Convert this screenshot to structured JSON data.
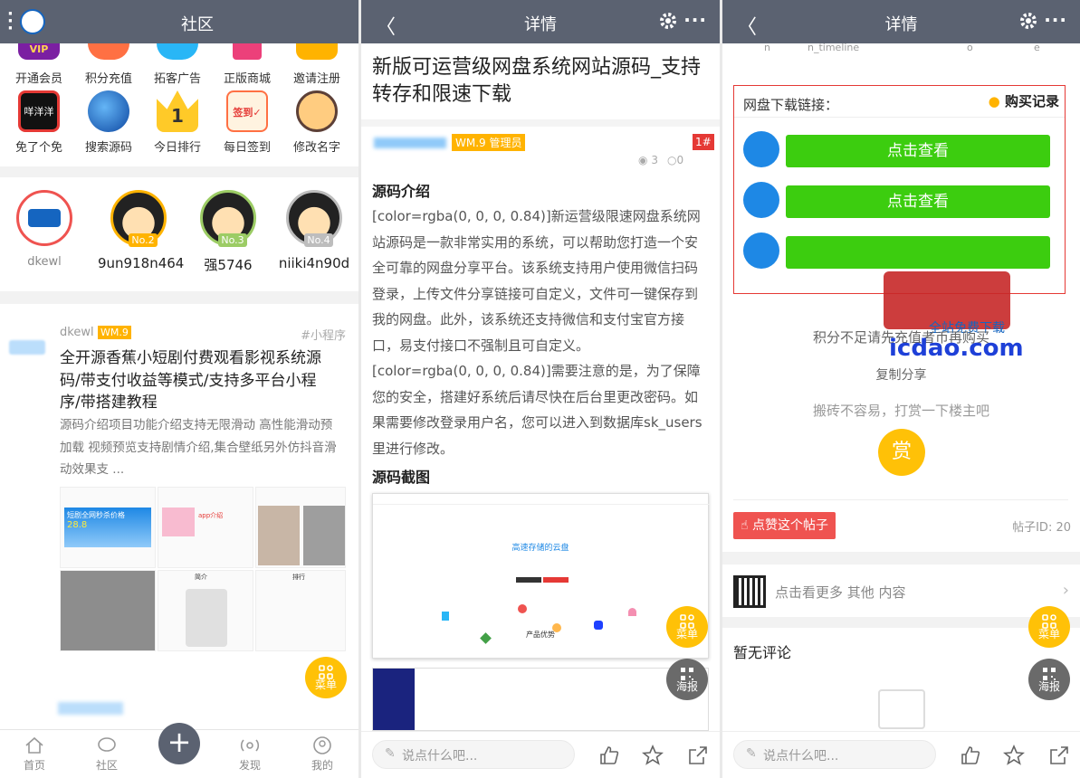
{
  "colors": {
    "topbar": "#5b6271",
    "accent_yellow": "#ffc107",
    "green": "#3ccd0f",
    "red": "#e53935"
  },
  "p1": {
    "title": "社区",
    "grid_row1": [
      "开通会员",
      "积分充值",
      "拓客广告",
      "正版商城",
      "邀请注册"
    ],
    "grid_row2": [
      "免了个免",
      "搜索源码",
      "今日排行",
      "每日签到",
      "修改名字"
    ],
    "ranking": [
      {
        "name": "dkewl",
        "badge": ""
      },
      {
        "name": "9un918n464",
        "badge": "No.2"
      },
      {
        "name": "强5746",
        "badge": "No.3"
      },
      {
        "name": "niiki4n90d",
        "badge": "No.4"
      }
    ],
    "post": {
      "author": "dkewl",
      "level": "WM.9",
      "tag": "#小程序",
      "title": "全开源香蕉小短剧付费观看影视系统源码/带支付收益等模式/支持多平台小程序/带搭建教程",
      "summary": "源码介绍项目功能介绍支持无限滑动 高性能滑动预加载 视频预览支持剧情介绍,集合壁纸另外仿抖音滑动效果支 ...",
      "thumb_texts": [
        "短剧全网秒杀价格",
        "28.8",
        "app介绍",
        "简介",
        "排行"
      ]
    },
    "fab": "菜单",
    "tabs": [
      "首页",
      "社区",
      "发现",
      "我的"
    ]
  },
  "p2": {
    "topbar_title": "详情",
    "title": "新版可运营级网盘系统网站源码_支持转存和限速下载",
    "level_badge": "WM.9 管理员",
    "floor": "1#",
    "views": "3",
    "comments": "0",
    "h_intro": "源码介绍",
    "para1": "[color=rgba(0, 0, 0, 0.84)]新运营级限速网盘系统网站源码是一款非常实用的系统，可以帮助您打造一个安全可靠的网盘分享平台。该系统支持用户使用微信扫码登录，上传文件分享链接可自定义，文件可一键保存到我的网盘。此外，该系统还支持微信和支付宝官方接口，易支付接口不强制且可自定义。",
    "para2": "[color=rgba(0, 0, 0, 0.84)]需要注意的是，为了保障您的安全，搭建好系统后请尽快在后台里更改密码。如果需要修改登录用户名，您可以进入到数据库sk_users里进行修改。",
    "h_shot": "源码截图",
    "shot_title": "高速存储的云盘",
    "shot_sub": "产品优势",
    "fab1": "菜单",
    "fab2": "海报",
    "input_placeholder": "说点什么吧..."
  },
  "p3": {
    "topbar_title": "详情",
    "faint_line": [
      "n",
      "n_timeline",
      "o",
      "e"
    ],
    "dl_label": "网盘下载链接：",
    "purchase": "购买记录",
    "btn1": "点击查看",
    "btn2": "点击查看",
    "notice": "积分不足请先充值者币再购买",
    "watermark_domain": "icdao.com",
    "watermark_tag": "全站免费下载",
    "copy_share": "复制分享",
    "reward_text": "搬砖不容易，打赏一下楼主吧",
    "reward_btn": "赏",
    "like_btn": "点赞这个帖子",
    "post_id": "帖子ID: 20",
    "more": "点击看更多 其他 内容",
    "no_comment": "暂无评论",
    "fab1": "菜单",
    "fab2": "海报",
    "input_placeholder": "说点什么吧..."
  }
}
